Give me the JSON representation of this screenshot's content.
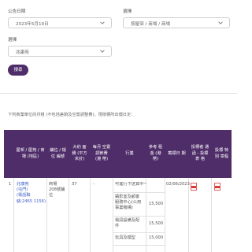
{
  "filters": {
    "date_label": "公告日期",
    "date_value": "2023年5月19日",
    "category_label": "選擇",
    "category_value": "按屋邨 / 商場 / 商場",
    "estate_label": "選擇",
    "estate_value": "兆康苑",
    "search_button": "搜尋"
  },
  "note": "下列商業單位的月租 (不包括差餉及空置調整費)，現按標所出價日定：",
  "table": {
    "headers": [
      "屋邨 / 屋苑 / 商場 (地區)",
      "鋪位 / 檔位 編號",
      "大約 面積 (平方 米計)",
      "每月 空置 調節費 (港 幣)",
      "行業",
      "參考 租金 (港 幣)",
      "截標日 期",
      "投標者 通函 - 投標表 格",
      "投標 特別 章程"
    ],
    "row": {
      "index": "1",
      "estate_lines": [
        "兆康苑",
        "(屯門)",
        "(電話聯",
        "絡:2465 1156)"
      ],
      "unit_lines": [
        "商場",
        "208號鋪",
        "位"
      ],
      "area": "37",
      "vacancy_fee": "-",
      "trades": [
        {
          "name_lines": [
            "可進行下述其中一項："
          ],
          "rent": ""
        },
        {
          "name_lines": [
            "攝影室及顧客",
            "服務中心(公用",
            "事業機構)"
          ],
          "rent": "15,500"
        },
        {
          "name_lines": [
            "電訊設備及配",
            "件"
          ],
          "rent": "15,500"
        },
        {
          "name_lines": [
            "玩具及模型"
          ],
          "rent": "15,000"
        }
      ],
      "closing_date": "02/06/2023"
    }
  },
  "colors": {
    "accent": "#4f2d69",
    "link": "#3b5ec4",
    "pdf_red": "#d93b3b"
  },
  "icons": {
    "chevron": "chevron-down-icon",
    "pdf": "pdf-file-icon"
  }
}
